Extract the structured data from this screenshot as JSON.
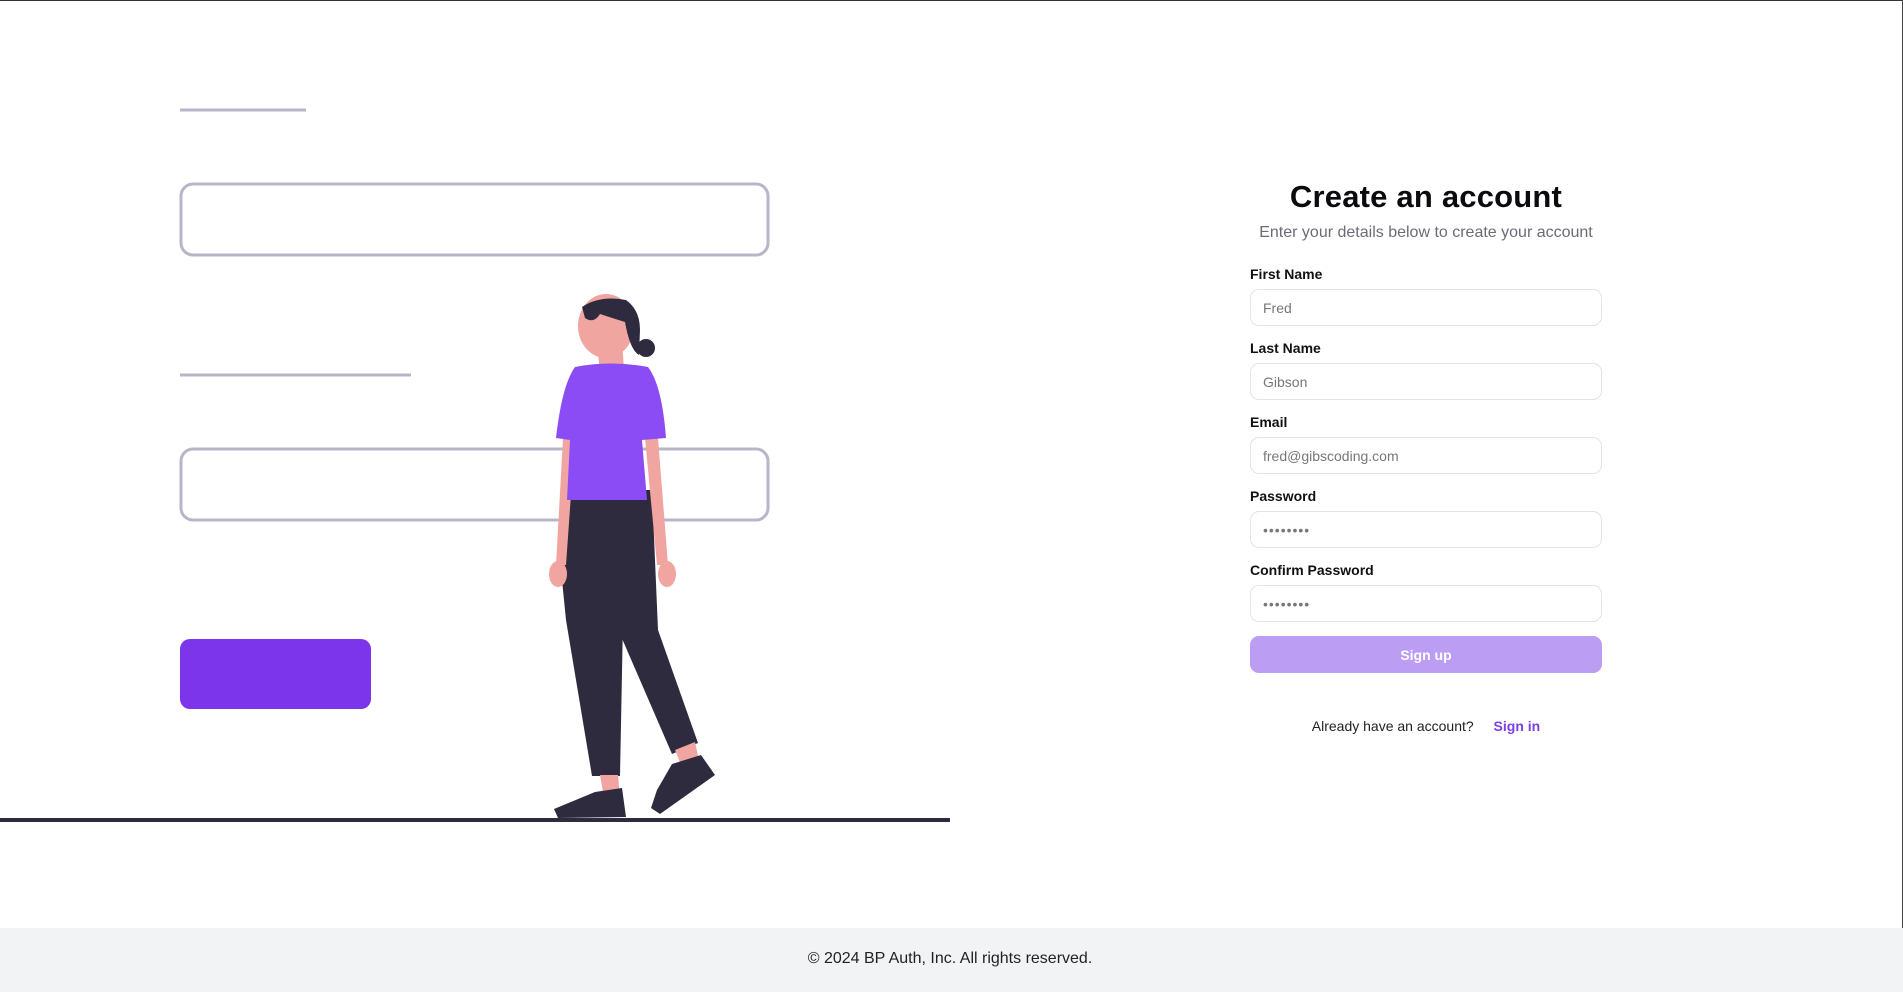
{
  "form": {
    "title": "Create an account",
    "subtitle": "Enter your details below to create your account",
    "fields": [
      {
        "label": "First Name",
        "placeholder": "Fred",
        "type": "text"
      },
      {
        "label": "Last Name",
        "placeholder": "Gibson",
        "type": "text"
      },
      {
        "label": "Email",
        "placeholder": "fred@gibscoding.com",
        "type": "email"
      },
      {
        "label": "Password",
        "placeholder": "••••••••",
        "type": "password"
      },
      {
        "label": "Confirm Password",
        "placeholder": "••••••••",
        "type": "password"
      }
    ],
    "submit_label": "Sign up",
    "signin_prompt": "Already have an account?",
    "signin_link": "Sign in"
  },
  "footer": {
    "text": "© 2024 BP Auth, Inc. All rights reserved."
  },
  "colors": {
    "accent": "#7b3fe8",
    "button_disabled": "#bb9df4",
    "illustration_button": "#7c35eb",
    "shirt": "#8c4cf5",
    "skin": "#f1a5a1",
    "dark": "#2f2b3e",
    "outline": "#b9b5c9",
    "footer_bg": "#f2f3f5"
  }
}
